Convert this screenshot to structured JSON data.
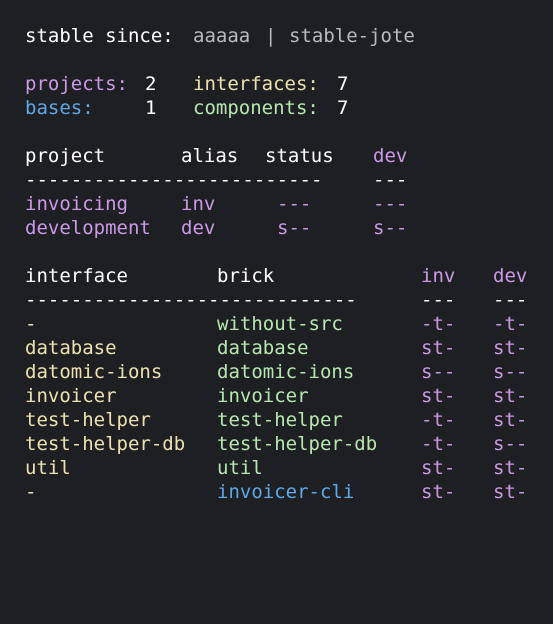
{
  "colors": {
    "background": "#1e1f22",
    "text": "#ffffff",
    "muted": "#b8bac0",
    "project": "#cc99e8",
    "base": "#5fa8e8",
    "interface": "#ece2b0",
    "component": "#b6e8b0"
  },
  "stable": {
    "label": "stable since:",
    "sha": "aaaaa",
    "separator": "|",
    "tag": "stable-jote"
  },
  "counts": {
    "projects_label": "projects:",
    "projects_value": "2",
    "interfaces_label": "interfaces:",
    "interfaces_value": "7",
    "bases_label": "bases:",
    "bases_value": "1",
    "components_label": "components:",
    "components_value": "7"
  },
  "projects_table": {
    "headers": {
      "project": "project",
      "alias": "alias",
      "status": "status",
      "dev": "dev"
    },
    "separator_main": "--------------------------",
    "separator_dev": "---",
    "rows": [
      {
        "project": "invoicing",
        "alias": "inv",
        "status": "---",
        "dev": "---"
      },
      {
        "project": "development",
        "alias": "dev",
        "status": "s--",
        "dev": "s--"
      }
    ]
  },
  "bricks_table": {
    "headers": {
      "interface": "interface",
      "brick": "brick",
      "inv": "inv",
      "dev": "dev"
    },
    "separator_main": "-----------------------------",
    "separator_inv": "---",
    "separator_dev": "---",
    "rows": [
      {
        "interface": "-",
        "brick": "without-src",
        "brick_type": "component",
        "inv": "-t-",
        "dev": "-t-"
      },
      {
        "interface": "database",
        "brick": "database",
        "brick_type": "component",
        "inv": "st-",
        "dev": "st-"
      },
      {
        "interface": "datomic-ions",
        "brick": "datomic-ions",
        "brick_type": "component",
        "inv": "s--",
        "dev": "s--"
      },
      {
        "interface": "invoicer",
        "brick": "invoicer",
        "brick_type": "component",
        "inv": "st-",
        "dev": "st-"
      },
      {
        "interface": "test-helper",
        "brick": "test-helper",
        "brick_type": "component",
        "inv": "-t-",
        "dev": "st-"
      },
      {
        "interface": "test-helper-db",
        "brick": "test-helper-db",
        "brick_type": "component",
        "inv": "-t-",
        "dev": "s--"
      },
      {
        "interface": "util",
        "brick": "util",
        "brick_type": "component",
        "inv": "st-",
        "dev": "st-"
      },
      {
        "interface": "-",
        "brick": "invoicer-cli",
        "brick_type": "base",
        "inv": "st-",
        "dev": "st-"
      }
    ]
  }
}
